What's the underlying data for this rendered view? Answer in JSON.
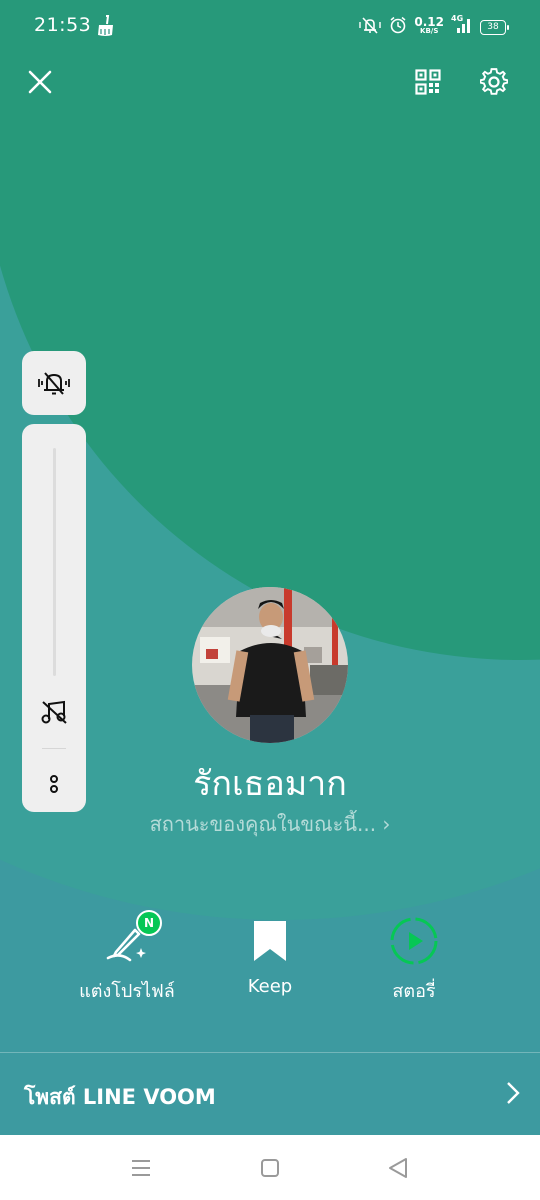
{
  "status_bar": {
    "time": "21:53",
    "net_speed": "0.12",
    "net_unit": "KB/S",
    "network_type": "4G",
    "battery": "38"
  },
  "topbar": {
    "close_icon": "close-icon",
    "qr_icon": "qr-code-icon",
    "settings_icon": "gear-icon"
  },
  "side_panel": {
    "notification_icon": "bell-off-icon",
    "music_icon": "music-off-icon",
    "more_icon": "more-icon"
  },
  "profile": {
    "name": "รักเธอมาก",
    "status_message": "สถานะของคุณในขณะนี้...",
    "status_chevron": "›"
  },
  "actions": [
    {
      "label": "แต่งโปรไฟล์",
      "icon": "edit-profile-icon",
      "badge": "N"
    },
    {
      "label": "Keep",
      "icon": "bookmark-icon"
    },
    {
      "label": "สตอรี่",
      "icon": "story-play-icon"
    }
  ],
  "voom": {
    "label": "โพสต์ LINE VOOM",
    "icon": "chevron-right-icon"
  },
  "colors": {
    "green": "#27997a",
    "teal": "#3d9aa0",
    "line_green": "#06c755"
  }
}
